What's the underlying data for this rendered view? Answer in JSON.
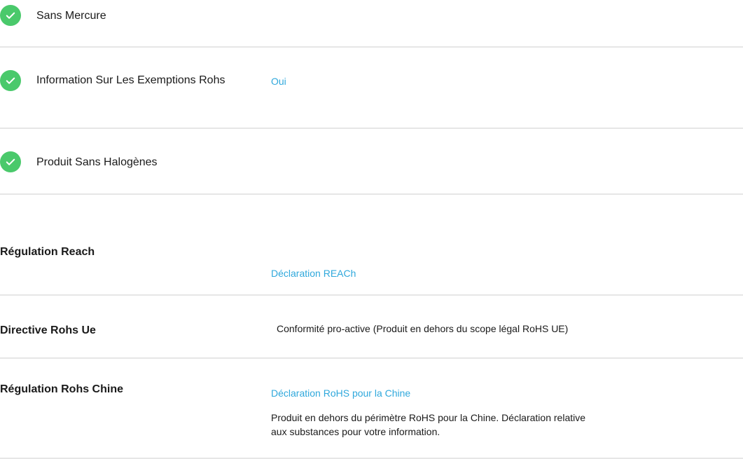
{
  "features": [
    {
      "label": "Sans Mercure",
      "value": ""
    },
    {
      "label": "Information Sur Les Exemptions Rohs",
      "value": "Oui"
    },
    {
      "label": "Produit Sans Halogènes",
      "value": ""
    }
  ],
  "regulations": {
    "reach": {
      "label": "Régulation Reach",
      "link": "Déclaration REACh"
    },
    "rohs_ue": {
      "label": "Directive Rohs Ue",
      "text": "Conformité pro-active (Produit en dehors du scope légal RoHS UE)"
    },
    "rohs_chine": {
      "label": "Régulation Rohs Chine",
      "link": "Déclaration RoHS pour la Chine",
      "text": "Produit en dehors du périmètre RoHS pour la Chine. Déclaration relative aux substances pour votre information."
    }
  },
  "colors": {
    "check": "#4ac96b",
    "link": "#2fa8dc",
    "divider": "#e6e6e6"
  }
}
